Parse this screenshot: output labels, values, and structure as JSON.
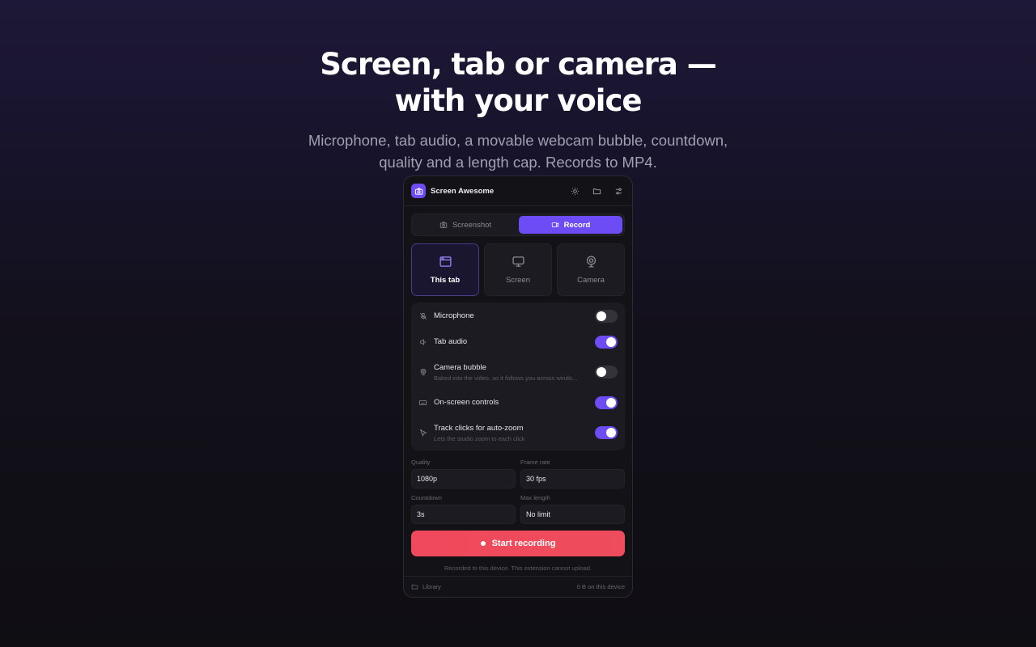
{
  "hero": {
    "title_line1": "Screen, tab or camera —",
    "title_line2": "with your voice",
    "subtitle": "Microphone, tab audio, a movable webcam bubble, countdown, quality and a length cap. Records to MP4."
  },
  "app": {
    "title": "Screen Awesome",
    "icons": [
      "sun-icon",
      "folder-icon",
      "sliders-icon"
    ]
  },
  "mode_tabs": [
    {
      "label": "Screenshot",
      "icon": "camera-icon",
      "active": false
    },
    {
      "label": "Record",
      "icon": "video-icon",
      "active": true
    }
  ],
  "sources": [
    {
      "label": "This tab",
      "icon": "browser-window-icon",
      "active": true
    },
    {
      "label": "Screen",
      "icon": "monitor-icon",
      "active": false
    },
    {
      "label": "Camera",
      "icon": "webcam-icon",
      "active": false
    }
  ],
  "options": [
    {
      "label": "Microphone",
      "sublabel": "",
      "icon": "mic-off-icon",
      "on": false
    },
    {
      "label": "Tab audio",
      "sublabel": "",
      "icon": "speaker-icon",
      "on": true
    },
    {
      "label": "Camera bubble",
      "sublabel": "Baked into the video, so it follows you across windo...",
      "icon": "webcam-icon",
      "on": false
    },
    {
      "label": "On-screen controls",
      "sublabel": "",
      "icon": "keyboard-icon",
      "on": true
    },
    {
      "label": "Track clicks for auto-zoom",
      "sublabel": "Lets the studio zoom to each click",
      "icon": "cursor-icon",
      "on": true
    }
  ],
  "settings": {
    "quality": {
      "label": "Quality",
      "value": "1080p"
    },
    "frame_rate": {
      "label": "Frame rate",
      "value": "30 fps"
    },
    "countdown": {
      "label": "Countdown",
      "value": "3s"
    },
    "max_length": {
      "label": "Max length",
      "value": "No limit"
    }
  },
  "start_button": {
    "label": "Start recording"
  },
  "note": "Recorded to this device. This extension cannot upload.",
  "footer": {
    "library_label": "Library",
    "storage": "0 B on this device"
  },
  "colors": {
    "accent": "#6d4bf5",
    "record": "#f0485c",
    "panel_bg": "#131217"
  }
}
